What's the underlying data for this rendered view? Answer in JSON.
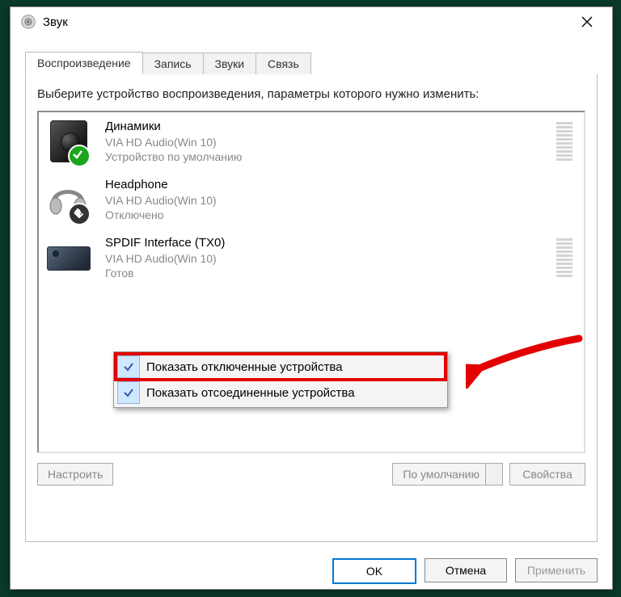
{
  "window": {
    "title": "Звук"
  },
  "tabs": [
    {
      "label": "Воспроизведение"
    },
    {
      "label": "Запись"
    },
    {
      "label": "Звуки"
    },
    {
      "label": "Связь"
    }
  ],
  "instruction": "Выберите устройство воспроизведения, параметры которого нужно изменить:",
  "devices": [
    {
      "name": "Динамики",
      "driver": "VIA HD Audio(Win 10)",
      "status": "Устройство по умолчанию"
    },
    {
      "name": "Headphone",
      "driver": "VIA HD Audio(Win 10)",
      "status": "Отключено"
    },
    {
      "name": "SPDIF Interface (TX0)",
      "driver": "VIA HD Audio(Win 10)",
      "status": "Готов"
    }
  ],
  "context_menu": [
    {
      "label": "Показать отключенные устройства"
    },
    {
      "label": "Показать отсоединенные устройства"
    }
  ],
  "device_buttons": {
    "configure": "Настроить",
    "default": "По умолчанию",
    "properties": "Свойства"
  },
  "footer": {
    "ok": "OK",
    "cancel": "Отмена",
    "apply": "Применить"
  }
}
